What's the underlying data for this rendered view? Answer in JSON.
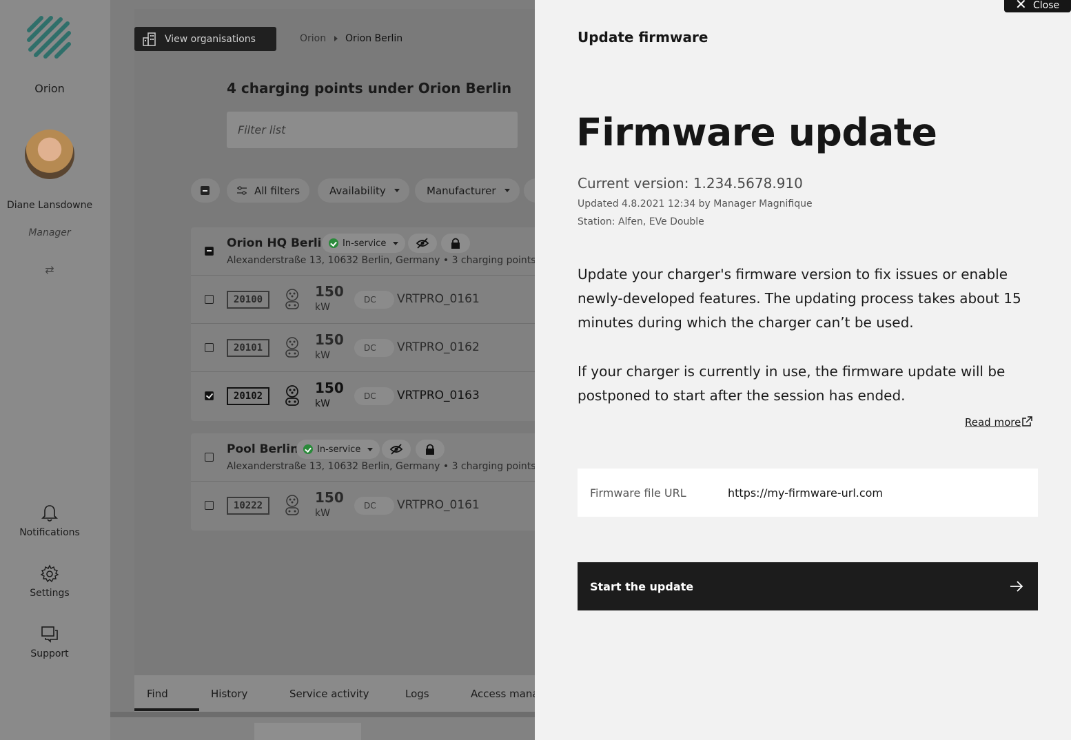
{
  "sidebar": {
    "org": "Orion",
    "user_name": "Diane Lansdowne",
    "user_role": "Manager",
    "links": {
      "notifications": "Notifications",
      "settings": "Settings",
      "support": "Support"
    }
  },
  "top": {
    "view_orgs": "View organisations",
    "breadcrumb": [
      "Orion",
      "Orion Berlin"
    ]
  },
  "list": {
    "title": "4 charging points under Orion Berlin",
    "filter_placeholder": "Filter list",
    "chips": {
      "all_filters": "All filters",
      "availability": "Availability",
      "manufacturer": "Manufacturer"
    }
  },
  "groups": [
    {
      "name": "Orion HQ Berlin",
      "status": "In-service",
      "address": "Alexanderstraße 13, 10632 Berlin, Germany",
      "count": "• 3 charging points",
      "rows": [
        {
          "id": "20100",
          "kw": "150",
          "unit": "kW",
          "type": "DC",
          "code": "VRTPRO_0161",
          "checked": false
        },
        {
          "id": "20101",
          "kw": "150",
          "unit": "kW",
          "type": "DC",
          "code": "VRTPRO_0162",
          "checked": false
        },
        {
          "id": "20102",
          "kw": "150",
          "unit": "kW",
          "type": "DC",
          "code": "VRTPRO_0163",
          "checked": true
        }
      ]
    },
    {
      "name": "Pool Berlin",
      "status": "In-service",
      "address": "Alexanderstraße 13, 10632 Berlin, Germany",
      "count": "• 3 charging points",
      "rows": [
        {
          "id": "10222",
          "kw": "150",
          "unit": "kW",
          "type": "DC",
          "code": "VRTPRO_0161",
          "checked": false
        }
      ]
    }
  ],
  "tabs": [
    "Find",
    "History",
    "Service activity",
    "Logs",
    "Access mana"
  ],
  "drawer": {
    "close": "Close",
    "header": "Update firmware",
    "title": "Firmware update",
    "version": "Current version: 1.234.5678.910",
    "updated": "Updated 4.8.2021 12:34 by Manager Magnifique",
    "station": "Station: Alfen, EVe Double",
    "para1": "Update your charger's firmware version to fix issues or enable newly-developed features. The updating process takes about 15 minutes during which the charger can’t be used.",
    "para2": "If your charger is currently in use, the firmware update will be postponed to start after the session has ended.",
    "read_more": "Read more",
    "url_label": "Firmware file URL",
    "url_value": "https://my-firmware-url.com",
    "start": "Start the update"
  }
}
